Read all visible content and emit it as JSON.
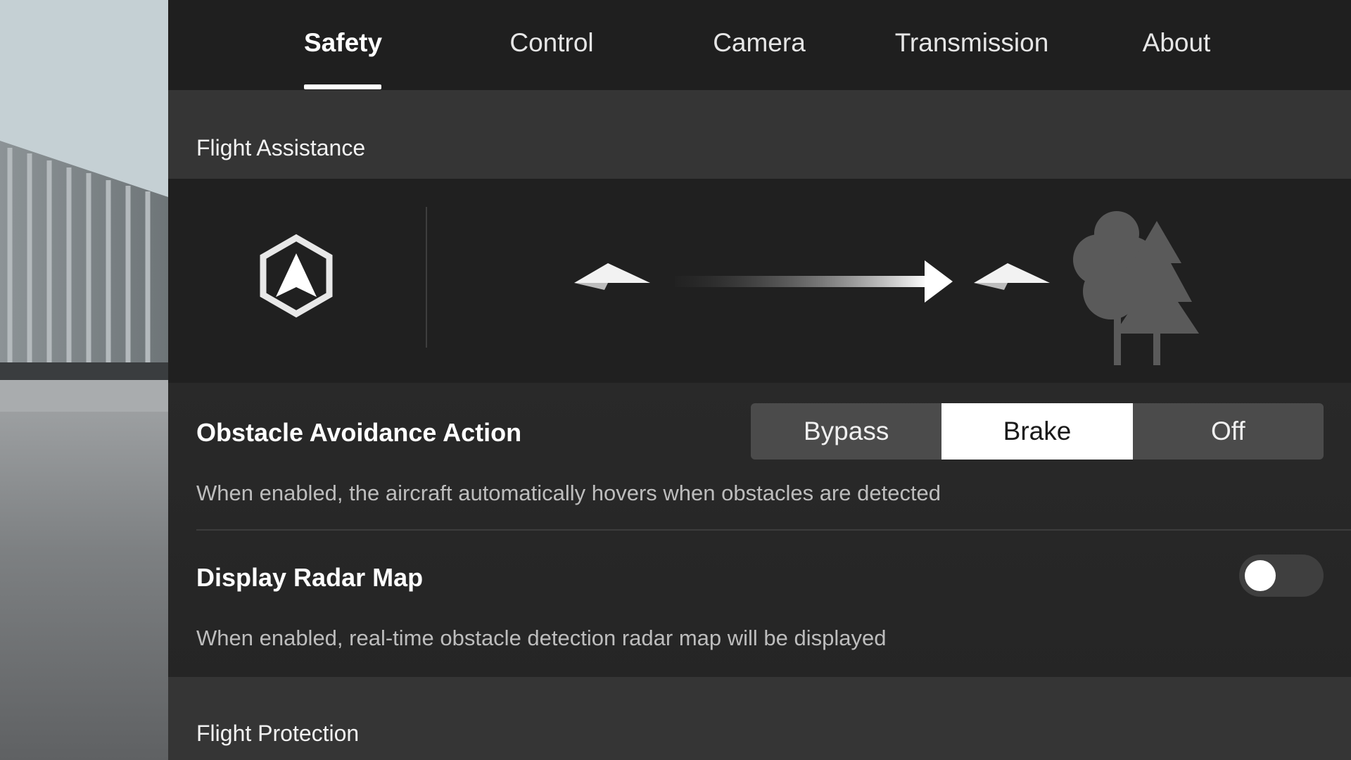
{
  "tabs": [
    {
      "label": "Safety",
      "active": true
    },
    {
      "label": "Control",
      "active": false
    },
    {
      "label": "Camera",
      "active": false
    },
    {
      "label": "Transmission",
      "active": false
    },
    {
      "label": "About",
      "active": false
    }
  ],
  "flight_assistance": {
    "section_title": "Flight Assistance",
    "illustration_icons": [
      "vision-sensor-icon",
      "paper-plane-icon",
      "arrow-right-icon",
      "paper-plane-icon",
      "trees-icon"
    ]
  },
  "obstacle_avoidance": {
    "title": "Obstacle Avoidance Action",
    "options": [
      "Bypass",
      "Brake",
      "Off"
    ],
    "selected": "Brake",
    "description": "When enabled, the aircraft automatically hovers when obstacles are detected"
  },
  "radar_map": {
    "title": "Display Radar Map",
    "enabled": false,
    "description": "When enabled, real-time obstacle detection radar map will be displayed"
  },
  "flight_protection": {
    "section_title": "Flight Protection"
  },
  "colors": {
    "panel_bg": "#262626",
    "selected_segment": "#ffffff",
    "text_primary": "#ffffff",
    "text_secondary": "#bdbdbd"
  }
}
